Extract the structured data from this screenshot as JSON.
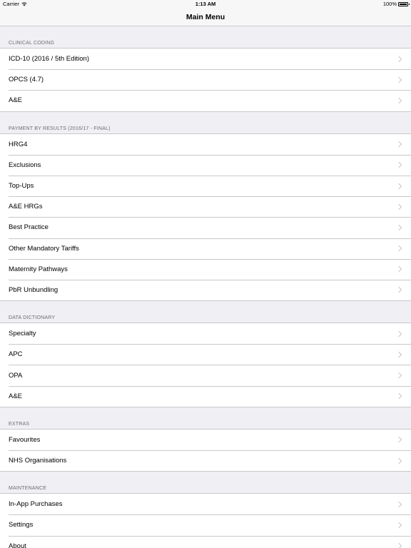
{
  "status": {
    "carrier": "Carrier",
    "time": "1:13 AM",
    "battery": "100%"
  },
  "nav": {
    "title": "Main Menu"
  },
  "sections": [
    {
      "header": "CLINICAL CODING",
      "items": [
        "ICD-10 (2016 / 5th Edition)",
        "OPCS (4.7)",
        "A&E"
      ]
    },
    {
      "header": "PAYMENT BY RESULTS (2016/17 - FINAL)",
      "items": [
        "HRG4",
        "Exclusions",
        "Top-Ups",
        "A&E HRGs",
        "Best Practice",
        "Other Mandatory Tariffs",
        "Maternity Pathways",
        "PbR Unbundling"
      ]
    },
    {
      "header": "DATA DICTIONARY",
      "items": [
        "Specialty",
        "APC",
        "OPA",
        "A&E"
      ]
    },
    {
      "header": "EXTRAS",
      "items": [
        "Favourites",
        "NHS Organisations"
      ]
    },
    {
      "header": "MAINTENANCE",
      "items": [
        "In-App Purchases",
        "Settings",
        "About"
      ]
    }
  ],
  "icons": {
    "row_accessory": "chevron-right-icon",
    "wifi": "wifi-icon",
    "battery": "battery-icon"
  }
}
